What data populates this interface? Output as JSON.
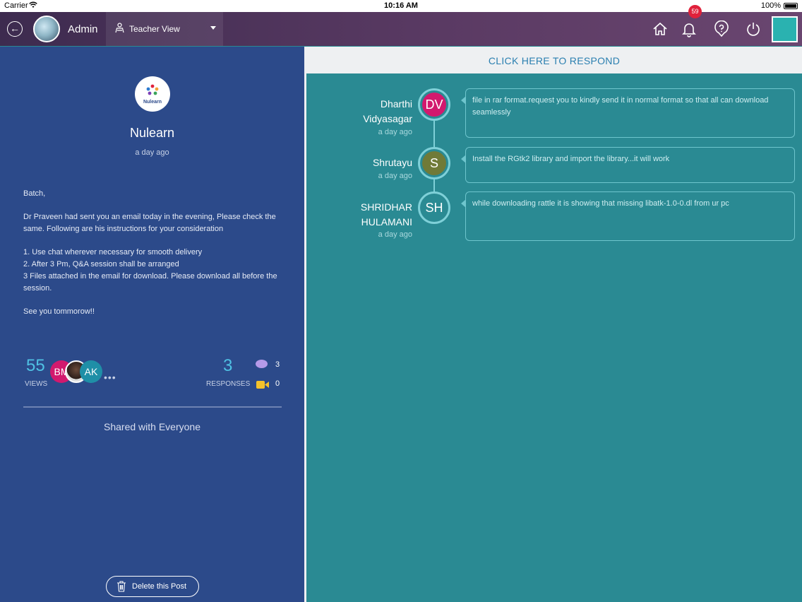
{
  "status_bar": {
    "carrier": "Carrier",
    "time": "10:16 AM",
    "battery": "100%"
  },
  "nav": {
    "user_name": "Admin",
    "view_label": "Teacher View",
    "notification_count": "59",
    "icons": [
      "back-arrow-icon",
      "home-icon",
      "bell-icon",
      "help-icon",
      "power-icon"
    ]
  },
  "post": {
    "logo_text": "Nulearn",
    "author": "Nulearn",
    "time": "a day ago",
    "body": {
      "greeting": "Batch,",
      "line1": "Dr Praveen had sent you an email today in the evening, Please check the same. Following are his instructions for your consideration",
      "item1": "1.  Use chat wherever necessary for smooth delivery",
      "item2": "2. After 3 Pm, Q&A session shall be arranged",
      "item3": "3  Files attached in the email for download. Please download all before the session.",
      "closing": "See you tommorow!!"
    },
    "stats": {
      "views_count": "55",
      "views_label": "VIEWS",
      "viewer_initials": [
        "BM",
        "AK"
      ],
      "more": "•••",
      "responses_count": "3",
      "responses_label": "RESPONSES",
      "chat_count": "3",
      "video_count": "0"
    },
    "shared_label": "Shared with Everyone",
    "delete_label": "Delete this Post"
  },
  "responses": {
    "respond_label": "CLICK HERE TO RESPOND",
    "items": [
      {
        "initials": "DV",
        "name_line1": "Dharthi",
        "name_line2": "Vidyasagar",
        "time": "a day ago",
        "text": "file in rar format.request you to kindly send it in normal format so that all can download seamlessly",
        "color": "#d2196e"
      },
      {
        "initials": "S",
        "name_line1": "Shrutayu",
        "time": "a day ago",
        "text": "Install the RGtk2 library and import the library...it will work",
        "color": "#707a38"
      },
      {
        "initials": "SH",
        "name_line1": "SHRIDHAR",
        "name_line2": "HULAMANI",
        "time": "a day ago",
        "text": "while downloading rattle it is showing that missing  libatk-1.0-0.dl from ur pc",
        "color": "#2a8a93"
      }
    ]
  },
  "colors": {
    "nav_bg": "#4b3358",
    "left_bg": "#2c4a8a",
    "right_bg": "#2a8a93",
    "accent_blue": "#4fc1e3",
    "badge_red": "#e0213b"
  }
}
